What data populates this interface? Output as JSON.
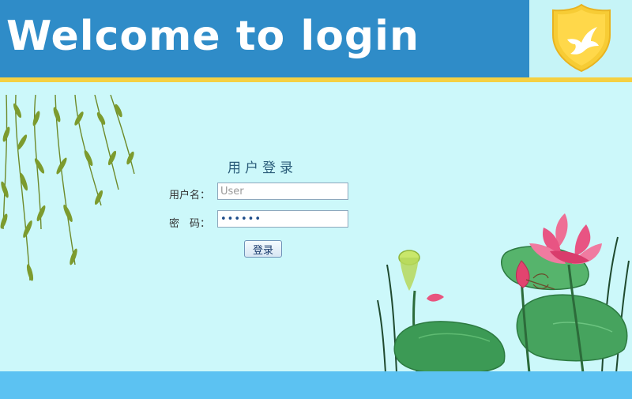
{
  "header": {
    "title": "Welcome to login",
    "logo_icon": "shield-dove-icon",
    "colors": {
      "bar": "#2f8cc8",
      "accent_line": "#f5d042",
      "shield": "#f7cc35"
    }
  },
  "login": {
    "title": "用户登录",
    "username_label": "用户名：",
    "username_value": "",
    "username_placeholder": "User",
    "password_label": "密　码：",
    "password_value": "••••••",
    "submit_label": "登录"
  },
  "decor": {
    "left_image": "willow-branches",
    "right_image": "lotus-pond"
  },
  "footer": {
    "color": "#5cc2f2"
  }
}
